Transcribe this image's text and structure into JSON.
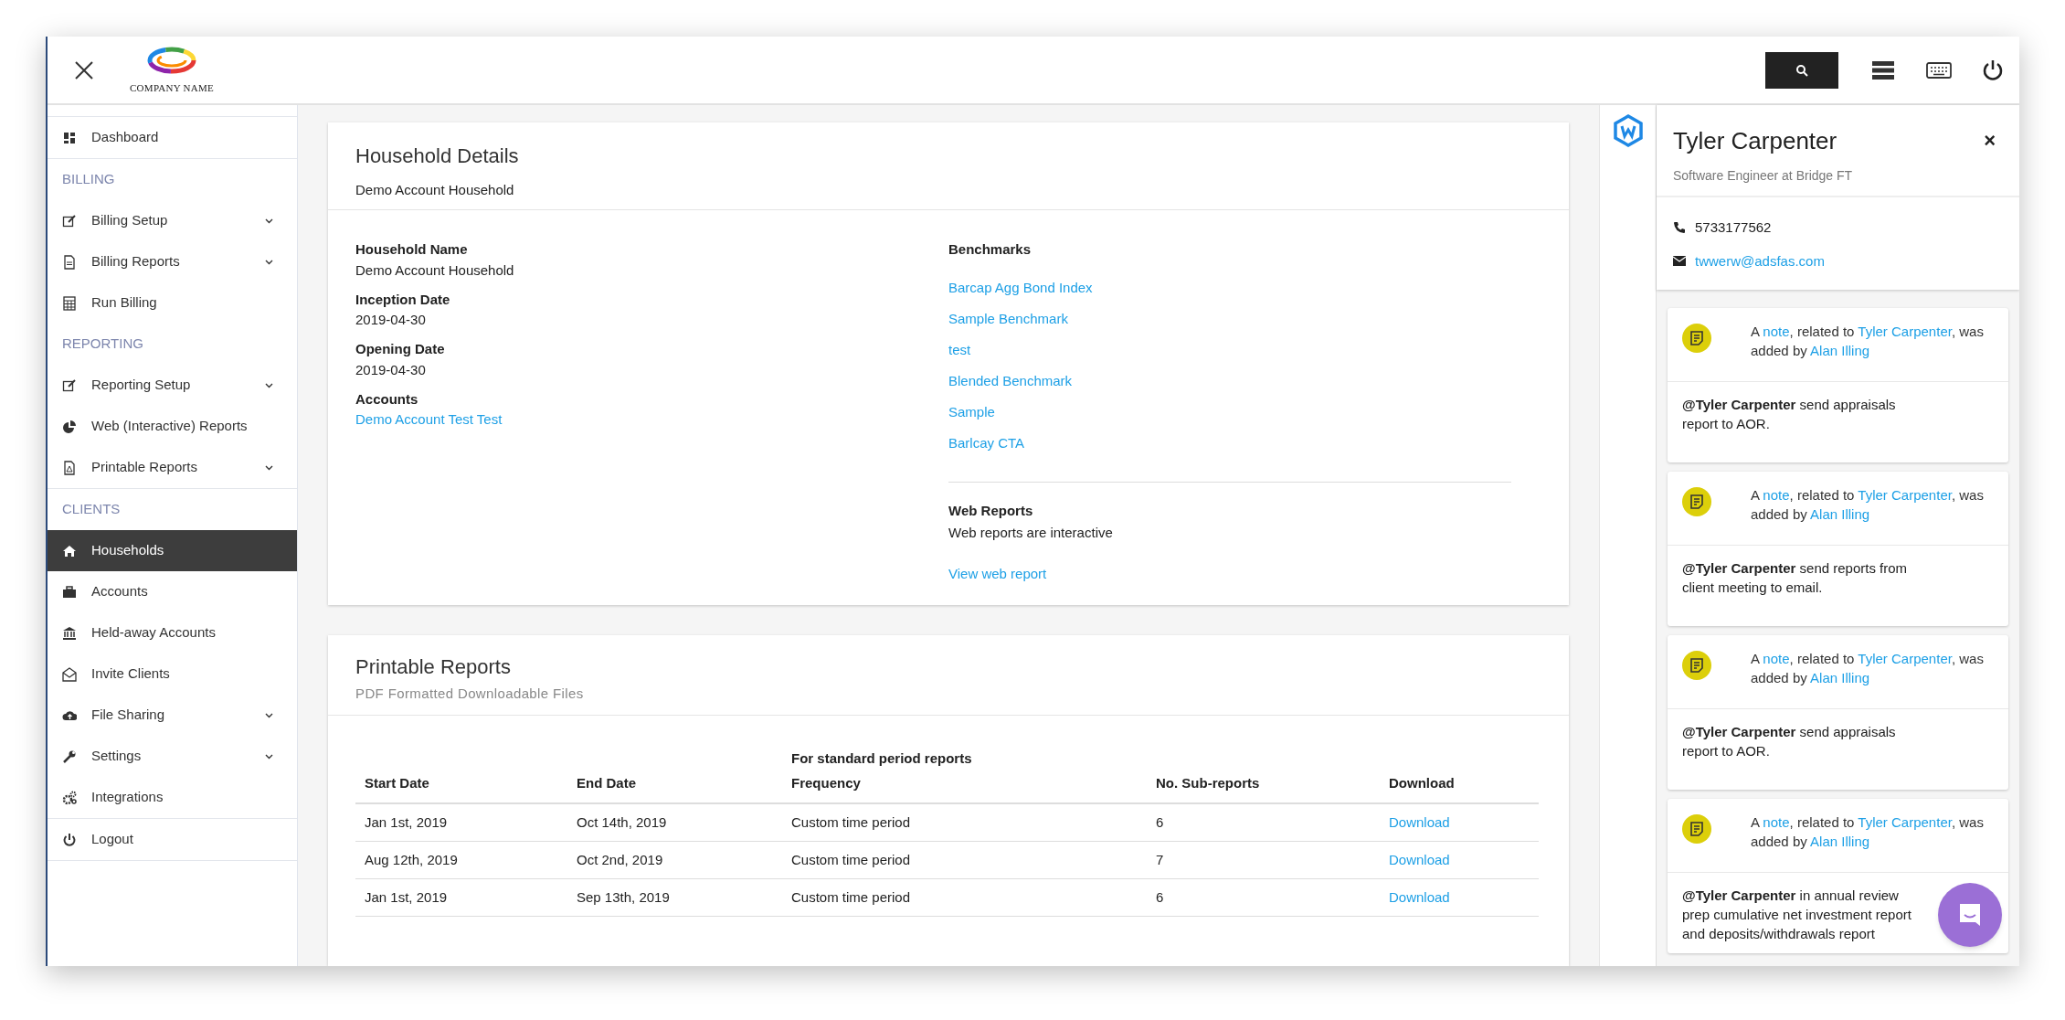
{
  "topbar": {
    "logo_text": "COMPANY NAME"
  },
  "sidebar": {
    "groups": [
      [
        {
          "kind": "item",
          "label": "Dashboard",
          "has_submenu": false,
          "selected": false
        }
      ],
      [
        {
          "kind": "heading",
          "label": "BILLING"
        },
        {
          "kind": "item",
          "label": "Billing Setup",
          "has_submenu": true,
          "selected": false
        },
        {
          "kind": "item",
          "label": "Billing Reports",
          "has_submenu": true,
          "selected": false
        },
        {
          "kind": "item",
          "label": "Run Billing",
          "has_submenu": false,
          "selected": false
        },
        {
          "kind": "heading",
          "label": "REPORTING"
        },
        {
          "kind": "item",
          "label": "Reporting Setup",
          "has_submenu": true,
          "selected": false
        },
        {
          "kind": "item",
          "label": "Web (Interactive) Reports",
          "has_submenu": false,
          "selected": false
        },
        {
          "kind": "item",
          "label": "Printable Reports",
          "has_submenu": true,
          "selected": false
        }
      ],
      [
        {
          "kind": "heading",
          "label": "CLIENTS"
        },
        {
          "kind": "item",
          "label": "Households",
          "has_submenu": false,
          "selected": true
        },
        {
          "kind": "item",
          "label": "Accounts",
          "has_submenu": false,
          "selected": false
        },
        {
          "kind": "item",
          "label": "Held-away Accounts",
          "has_submenu": false,
          "selected": false
        },
        {
          "kind": "item",
          "label": "Invite Clients",
          "has_submenu": false,
          "selected": false
        },
        {
          "kind": "item",
          "label": "File Sharing",
          "has_submenu": true,
          "selected": false
        },
        {
          "kind": "item",
          "label": "Settings",
          "has_submenu": true,
          "selected": false
        },
        {
          "kind": "item",
          "label": "Integrations",
          "has_submenu": false,
          "selected": false
        }
      ],
      [
        {
          "kind": "item",
          "label": "Logout",
          "has_submenu": false,
          "selected": false
        }
      ]
    ]
  },
  "household": {
    "title": "Household Details",
    "subtitle": "Demo Account Household",
    "fields": [
      {
        "label": "Household Name",
        "value": "Demo Account Household",
        "kind": "text"
      },
      {
        "label": "Inception Date",
        "value": "2019-04-30",
        "kind": "text"
      },
      {
        "label": "Opening Date",
        "value": "2019-04-30",
        "kind": "text"
      },
      {
        "label": "Accounts",
        "value": "Demo Account Test Test",
        "kind": "link"
      }
    ],
    "benchmarks": {
      "title": "Benchmarks",
      "items": [
        "Barcap Agg Bond Index",
        "Sample Benchmark",
        "test",
        "Blended Benchmark",
        "Sample",
        "Barlcay CTA"
      ]
    },
    "web_reports": {
      "title": "Web Reports",
      "description": "Web reports are interactive",
      "link": "View web report"
    }
  },
  "printable_reports": {
    "title": "Printable Reports",
    "subtitle": "PDF Formatted Downloadable Files",
    "columns": [
      {
        "label": "Start Date"
      },
      {
        "label": "End Date"
      },
      {
        "label": "Frequency",
        "note": "For standard period reports"
      },
      {
        "label": "No. Sub-reports"
      },
      {
        "label": "Download"
      }
    ],
    "rows": [
      [
        "Jan 1st, 2019",
        "Oct 14th, 2019",
        "Custom time period",
        "6",
        "Download"
      ],
      [
        "Aug 12th, 2019",
        "Oct 2nd, 2019",
        "Custom time period",
        "7",
        "Download"
      ],
      [
        "Jan 1st, 2019",
        "Sep 13th, 2019",
        "Custom time period",
        "6",
        "Download"
      ]
    ]
  },
  "contact": {
    "name": "Tyler Carpenter",
    "role": "Software Engineer at Bridge FT",
    "close": "×",
    "phone": "5733177562",
    "email": "twwerw@adsfas.com",
    "notes": [
      {
        "header": [
          {
            "kind": "text",
            "text": "A "
          },
          {
            "kind": "link",
            "text": "note"
          },
          {
            "kind": "text",
            "text": ", related to "
          },
          {
            "kind": "link",
            "text": "Tyler Carpenter"
          },
          {
            "kind": "text",
            "text": ", was added by "
          },
          {
            "kind": "link",
            "text": "Alan Illing"
          }
        ],
        "body": "**@Tyler Carpenter** send appraisals report to AOR."
      },
      {
        "header": [
          {
            "kind": "text",
            "text": "A "
          },
          {
            "kind": "link",
            "text": "note"
          },
          {
            "kind": "text",
            "text": ", related to "
          },
          {
            "kind": "link",
            "text": "Tyler Carpenter"
          },
          {
            "kind": "text",
            "text": ", was added by "
          },
          {
            "kind": "link",
            "text": "Alan Illing"
          }
        ],
        "body": "**@Tyler Carpenter** send reports from client meeting to email."
      },
      {
        "header": [
          {
            "kind": "text",
            "text": "A "
          },
          {
            "kind": "link",
            "text": "note"
          },
          {
            "kind": "text",
            "text": ", related to "
          },
          {
            "kind": "link",
            "text": "Tyler Carpenter"
          },
          {
            "kind": "text",
            "text": ", was added by "
          },
          {
            "kind": "link",
            "text": "Alan Illing"
          }
        ],
        "body": "**@Tyler Carpenter** send appraisals report to AOR."
      },
      {
        "header": [
          {
            "kind": "text",
            "text": "A "
          },
          {
            "kind": "link",
            "text": "note"
          },
          {
            "kind": "text",
            "text": ", related to "
          },
          {
            "kind": "link",
            "text": "Tyler Carpenter"
          },
          {
            "kind": "text",
            "text": ", was added by "
          },
          {
            "kind": "link",
            "text": "Alan Illing"
          }
        ],
        "body": "**@Tyler Carpenter** in annual review prep cumulative net investment report and deposits/withdrawals report"
      }
    ]
  }
}
